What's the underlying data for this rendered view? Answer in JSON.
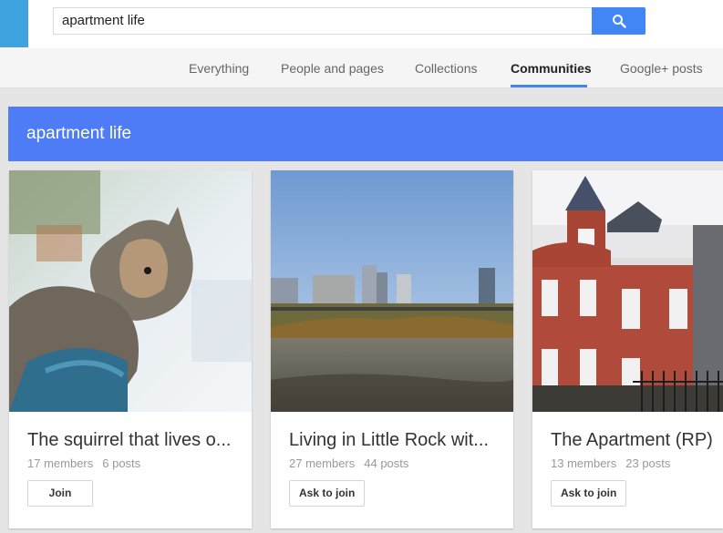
{
  "search": {
    "query": "apartment life"
  },
  "tabs": [
    {
      "label": "Everything"
    },
    {
      "label": "People and pages"
    },
    {
      "label": "Collections"
    },
    {
      "label": "Communities",
      "active": true
    },
    {
      "label": "Google+ posts"
    }
  ],
  "banner": {
    "title": "apartment life"
  },
  "communities": [
    {
      "title": "The squirrel that lives o...",
      "members": "17 members",
      "posts": "6 posts",
      "action": "Join"
    },
    {
      "title": "Living in Little Rock wit...",
      "members": "27 members",
      "posts": "44 posts",
      "action": "Ask to join"
    },
    {
      "title": "The Apartment (RP)",
      "members": "13 members",
      "posts": "23 posts",
      "action": "Ask to join"
    }
  ],
  "colors": {
    "accent": "#4285f4",
    "banner": "#4d7cf6",
    "app_badge": "#3fa3df"
  },
  "icons": {
    "search_button": "search-icon"
  }
}
